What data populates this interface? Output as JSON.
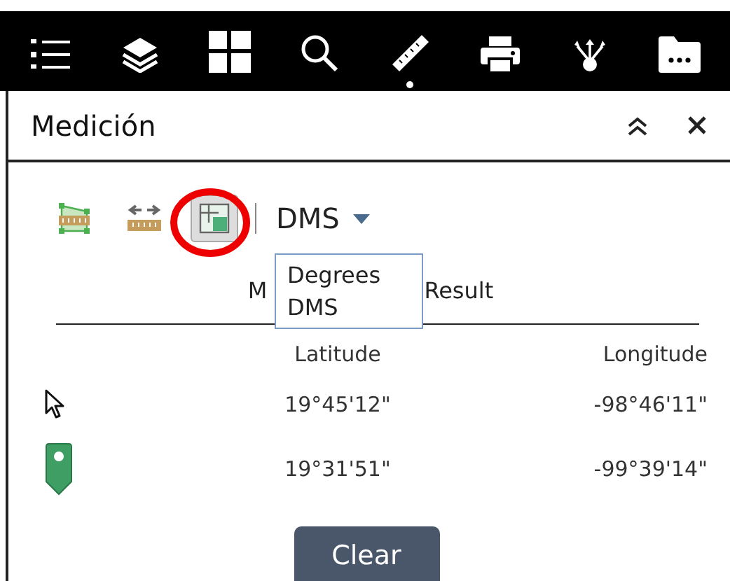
{
  "toolbar": {
    "items": [
      {
        "kind": "list",
        "active": false
      },
      {
        "kind": "layers",
        "active": false
      },
      {
        "kind": "grid",
        "active": false
      },
      {
        "kind": "search",
        "active": false
      },
      {
        "kind": "ruler",
        "active": true
      },
      {
        "kind": "print",
        "active": false
      },
      {
        "kind": "share",
        "active": false
      },
      {
        "kind": "folder",
        "active": false
      }
    ]
  },
  "panel": {
    "title": "Medición"
  },
  "tools": [
    {
      "kind": "area",
      "selected": false
    },
    {
      "kind": "distance",
      "selected": false
    },
    {
      "kind": "location",
      "selected": true
    }
  ],
  "unit_select": {
    "value": "DMS",
    "options": [
      "Degrees",
      "DMS"
    ]
  },
  "result_title": {
    "visible_start": "M",
    "visible_end": "Result"
  },
  "table": {
    "columns": [
      "Latitude",
      "Longitude"
    ],
    "rows": [
      {
        "kind": "cursor",
        "cells": [
          "19°45'12\"",
          "-98°46'11\""
        ]
      },
      {
        "kind": "pin",
        "cells": [
          "19°31'51\"",
          "-99°39'14\""
        ]
      }
    ]
  },
  "buttons": [
    "Clear"
  ]
}
